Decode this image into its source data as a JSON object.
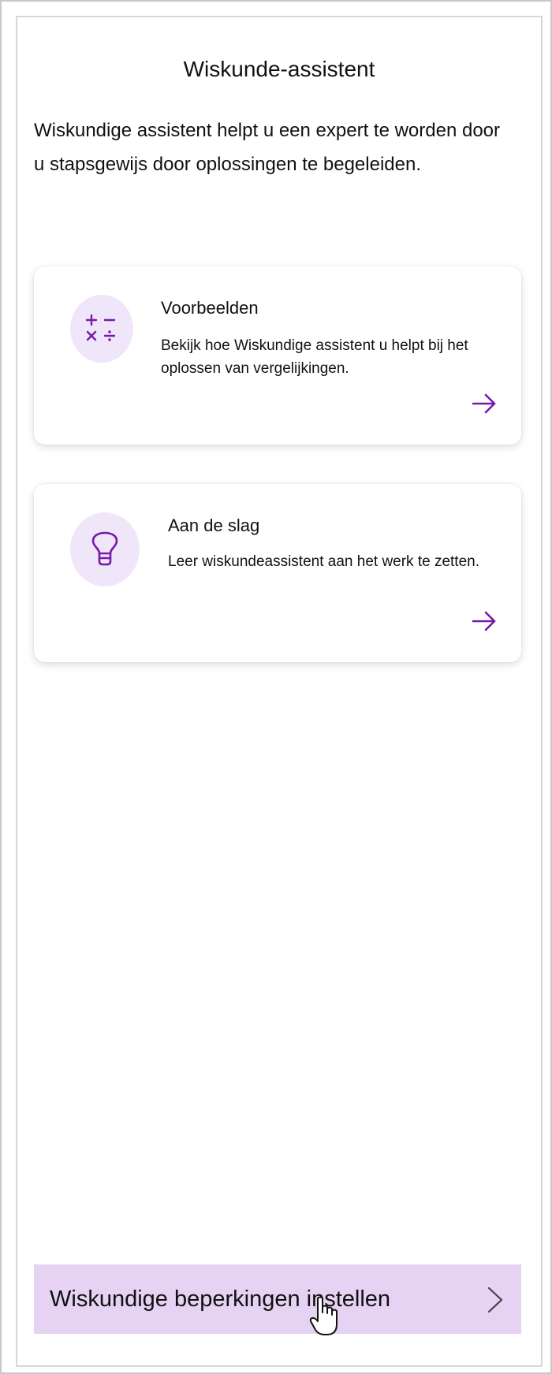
{
  "header": {
    "title": "Wiskunde-assistent"
  },
  "intro": {
    "text": "Wiskundige assistent helpt u een expert te worden door u stapsgewijs door oplossingen te begeleiden."
  },
  "cards": [
    {
      "title": "Voorbeelden",
      "description": "Bekijk hoe Wiskundige assistent u helpt bij het oplossen van vergelijkingen.",
      "icon": "math-operators-icon",
      "action_icon": "arrow-right-icon"
    },
    {
      "title": "Aan de slag",
      "description": "Leer wiskundeassistent aan het werk te zetten.",
      "icon": "lightbulb-icon",
      "action_icon": "arrow-right-icon"
    }
  ],
  "footer": {
    "settings_label": "Wiskundige beperkingen instellen",
    "settings_icon": "chevron-right-icon"
  },
  "colors": {
    "accent": "#7719aa",
    "icon_background": "#f0e6fa",
    "settings_background": "#e6d2f2"
  }
}
